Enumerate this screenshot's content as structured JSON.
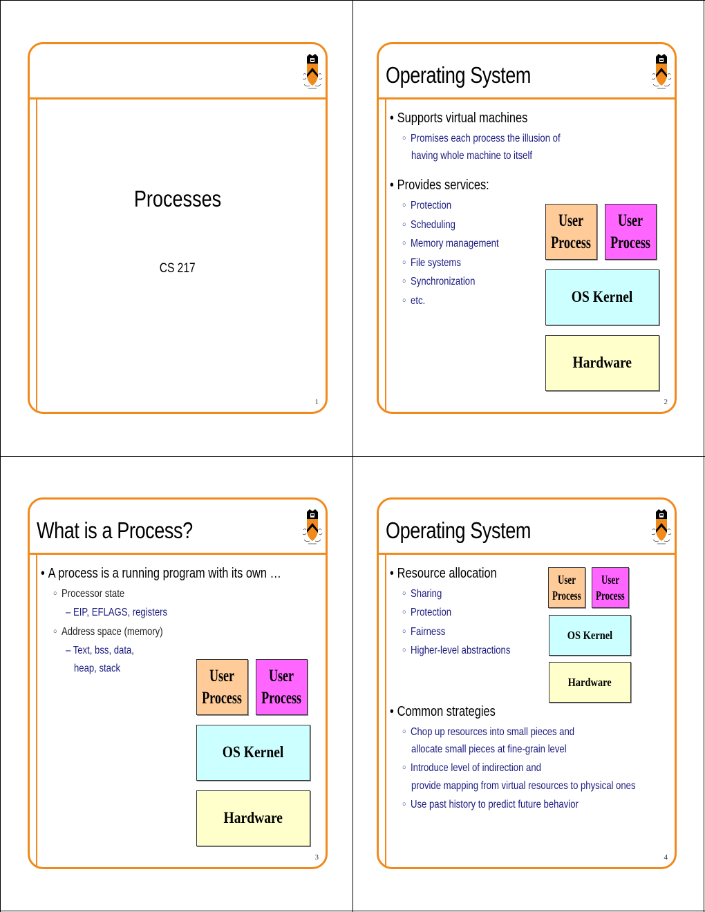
{
  "slides": [
    {
      "title": "",
      "center_title": "Processes",
      "center_subtitle": "CS 217",
      "page_number": "1",
      "logo_icon": "princeton-shield-icon"
    },
    {
      "title": "Operating System",
      "page_number": "2",
      "logo_icon": "princeton-shield-icon",
      "bullets": [
        {
          "text": "Supports virtual machines",
          "sub": [
            "Promises each process the illusion of",
            "having whole machine to itself"
          ]
        },
        {
          "text": "Provides services:",
          "sub": [
            "Protection",
            "Scheduling",
            "Memory management",
            "File systems",
            "Synchronization",
            "etc."
          ]
        }
      ],
      "diagram": {
        "user_process_1": [
          "User",
          "Process"
        ],
        "user_process_2": [
          "User",
          "Process"
        ],
        "kernel": "OS Kernel",
        "hardware": "Hardware"
      }
    },
    {
      "title": "What is a Process?",
      "page_number": "3",
      "logo_icon": "princeton-shield-icon",
      "bullets": [
        {
          "text": "A process is a running program with its own …",
          "sub": [
            {
              "text": "Processor state",
              "sub": [
                "– EIP, EFLAGS, registers"
              ]
            },
            {
              "text": "Address space (memory)",
              "sub": [
                "– Text, bss, data,",
                "heap, stack"
              ]
            }
          ]
        }
      ],
      "diagram": {
        "user_process_1": [
          "User",
          "Process"
        ],
        "user_process_2": [
          "User",
          "Process"
        ],
        "kernel": "OS Kernel",
        "hardware": "Hardware"
      }
    },
    {
      "title": "Operating System",
      "page_number": "4",
      "logo_icon": "princeton-shield-icon",
      "bullets": [
        {
          "text": "Resource allocation",
          "sub": [
            "Sharing",
            "Protection",
            "Fairness",
            "Higher-level abstractions"
          ]
        },
        {
          "text": "Common strategies",
          "sub": [
            "Chop up resources into small pieces and",
            "allocate small pieces at fine-grain level",
            "Introduce level of indirection and",
            "provide mapping from virtual resources to physical ones",
            "Use past history to predict future behavior"
          ]
        }
      ],
      "diagram": {
        "user_process_1": [
          "User",
          "Process"
        ],
        "user_process_2": [
          "User",
          "Process"
        ],
        "kernel": "OS Kernel",
        "hardware": "Hardware"
      }
    }
  ],
  "colors": {
    "accent": "#f08a1c",
    "user_process_1": "#ffcc99",
    "user_process_2": "#ff66ff",
    "kernel": "#ccffff",
    "hardware": "#ffffcc",
    "subtext": "#1a1a80"
  }
}
